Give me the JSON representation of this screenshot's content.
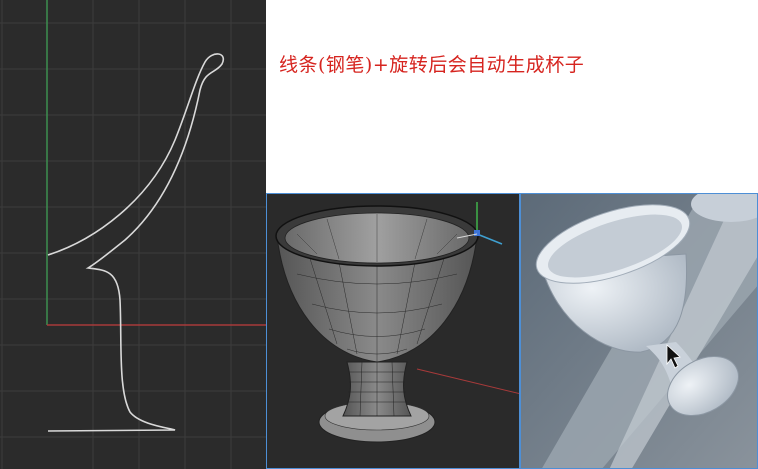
{
  "caption": {
    "text": "线条(钢笔)+旋转后会自动生成杯子",
    "color": "#d6241f"
  },
  "viewports": {
    "spline": {
      "name": "spline-profile-viewport",
      "grid": true
    },
    "wireframe": {
      "name": "wireframe-viewport",
      "label": ""
    },
    "render": {
      "name": "rendered-cup-viewport"
    }
  },
  "colors": {
    "viewport_bg": "#2b2b2b",
    "grid_line": "#3d3d3d",
    "axis_y": "#3d8f4f",
    "axis_x": "#a83a3a",
    "spline": "#d9d9d9",
    "selection_border": "#4d8fd6",
    "render_cup": "#d8e0e8"
  },
  "icons": [
    "mouse-cursor-icon",
    "move-gizmo-icon"
  ]
}
